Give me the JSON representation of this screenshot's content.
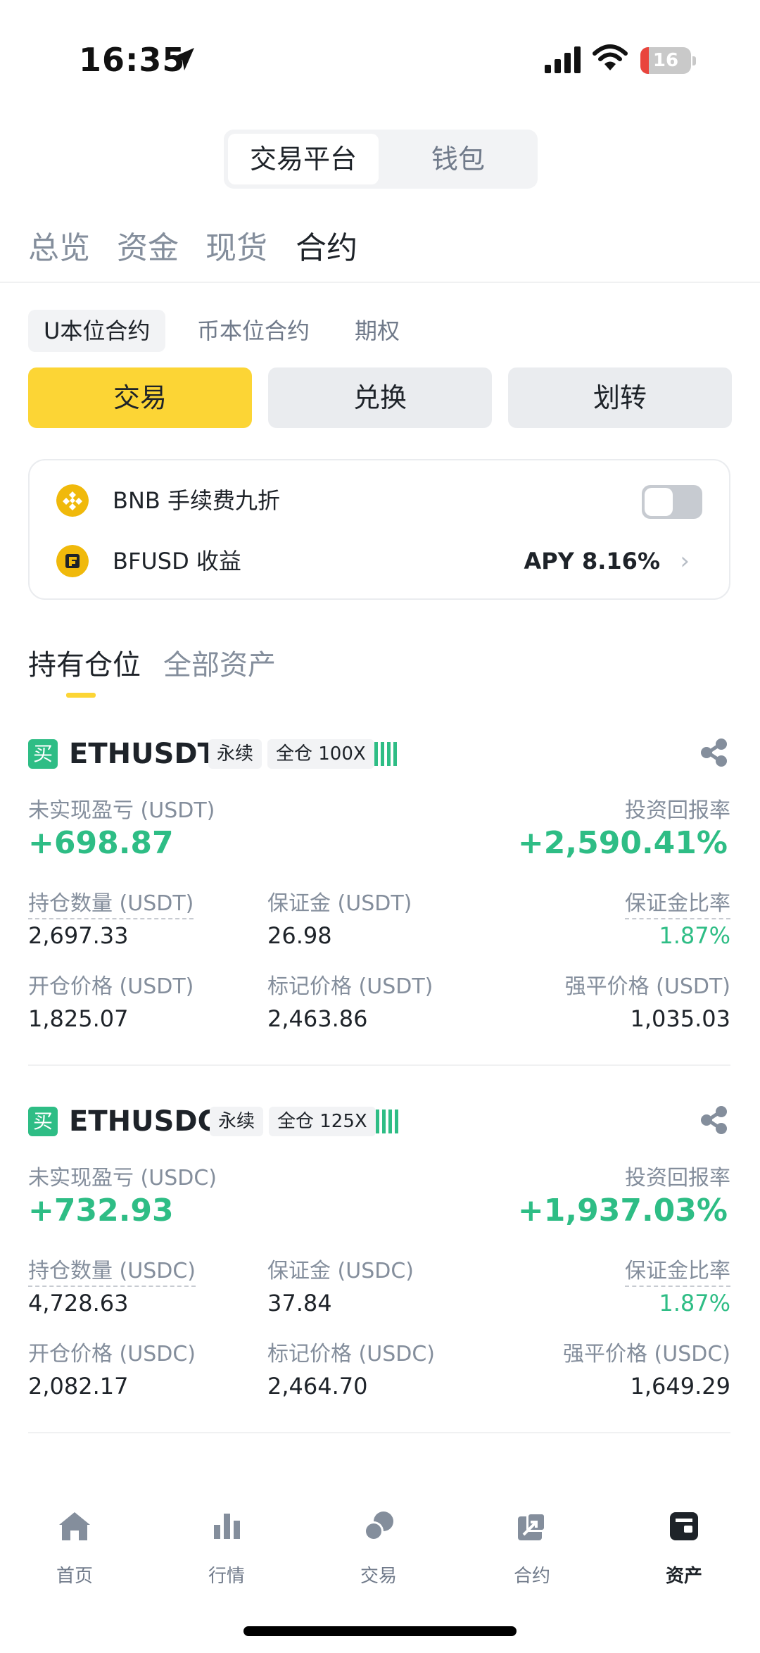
{
  "status_bar": {
    "time": "16:35",
    "battery": "16"
  },
  "platform_switch": [
    "交易平台",
    "钱包"
  ],
  "main_tabs": [
    "总览",
    "资金",
    "现货",
    "合约"
  ],
  "sub_tabs": [
    "U本位合约",
    "币本位合约",
    "期权"
  ],
  "actions": [
    "交易",
    "兑换",
    "划转"
  ],
  "settings": {
    "bnb_label": "BNB 手续费九折",
    "bfusd_label": "BFUSD 收益",
    "apy": "APY 8.16%"
  },
  "holdings_tabs": [
    "持有仓位",
    "全部资产"
  ],
  "positions": [
    {
      "side": "买",
      "symbol": "ETHUSDT",
      "type": "永续",
      "leverage": "全仓 100X",
      "pnl_label": "未实现盈亏 (USDT)",
      "pnl": "+698.87",
      "roe_label": "投资回报率",
      "roe": "+2,590.41%",
      "size_label": "持仓数量 (USDT)",
      "size": "2,697.33",
      "margin_label": "保证金 (USDT)",
      "margin": "26.98",
      "margin_ratio_label": "保证金比率",
      "margin_ratio": "1.87%",
      "entry_label": "开仓价格 (USDT)",
      "entry": "1,825.07",
      "mark_label": "标记价格 (USDT)",
      "mark": "2,463.86",
      "liq_label": "强平价格 (USDT)",
      "liq": "1,035.03"
    },
    {
      "side": "买",
      "symbol": "ETHUSDC",
      "type": "永续",
      "leverage": "全仓 125X",
      "pnl_label": "未实现盈亏 (USDC)",
      "pnl": "+732.93",
      "roe_label": "投资回报率",
      "roe": "+1,937.03%",
      "size_label": "持仓数量 (USDC)",
      "size": "4,728.63",
      "margin_label": "保证金 (USDC)",
      "margin": "37.84",
      "margin_ratio_label": "保证金比率",
      "margin_ratio": "1.87%",
      "entry_label": "开仓价格 (USDC)",
      "entry": "2,082.17",
      "mark_label": "标记价格 (USDC)",
      "mark": "2,464.70",
      "liq_label": "强平价格 (USDC)",
      "liq": "1,649.29"
    }
  ],
  "bottom_nav": [
    {
      "label": "首页",
      "icon": "home-icon"
    },
    {
      "label": "行情",
      "icon": "chart-icon"
    },
    {
      "label": "交易",
      "icon": "trade-icon"
    },
    {
      "label": "合约",
      "icon": "futures-icon"
    },
    {
      "label": "资产",
      "icon": "wallet-icon"
    }
  ],
  "colors": {
    "accent": "#fcd535",
    "green": "#2ebd85",
    "bnb": "#f0b90b"
  }
}
